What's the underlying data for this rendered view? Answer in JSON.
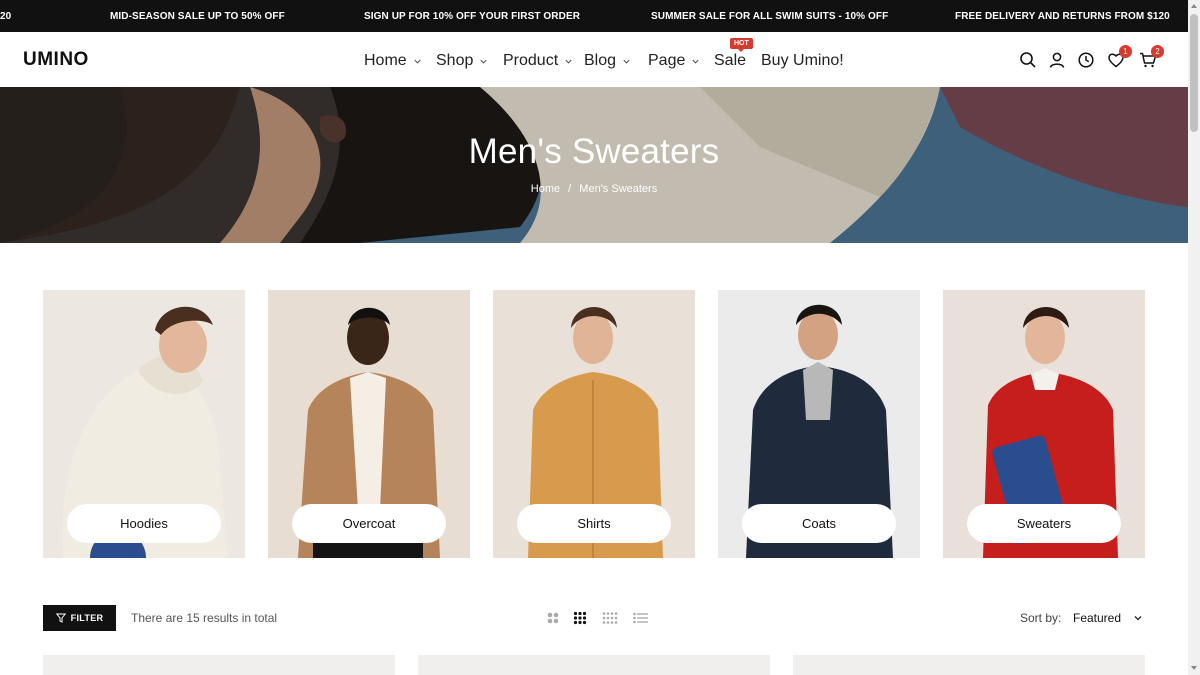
{
  "announcements": [
    "20",
    "MID-SEASON SALE UP TO 50% OFF",
    "SIGN UP FOR 10% OFF YOUR FIRST ORDER",
    "SUMMER SALE FOR ALL SWIM SUITS - 10% OFF",
    "FREE DELIVERY AND RETURNS FROM $120"
  ],
  "header": {
    "logo": "UMINO",
    "nav": [
      {
        "label": "Home",
        "has_dropdown": true
      },
      {
        "label": "Shop",
        "has_dropdown": true
      },
      {
        "label": "Product",
        "has_dropdown": true
      },
      {
        "label": "Blog",
        "has_dropdown": true
      },
      {
        "label": "Page",
        "has_dropdown": true
      },
      {
        "label": "Sale",
        "has_dropdown": false
      },
      {
        "label": "Buy Umino!",
        "has_dropdown": false
      }
    ],
    "hot_badge": "HOT",
    "icons": [
      "search-icon",
      "account-icon",
      "recently-viewed-icon",
      "wishlist-icon",
      "cart-icon"
    ],
    "wishlist_count": "1",
    "cart_count": "2"
  },
  "hero": {
    "title": "Men's Sweaters",
    "breadcrumb": [
      "Home",
      "Men's Sweaters"
    ],
    "breadcrumb_separator": "/"
  },
  "categories": [
    {
      "label": "Hoodies",
      "bg": "#ece7e1",
      "garment": "#f1ece2"
    },
    {
      "label": "Overcoat",
      "bg": "#e8ddd2",
      "garment": "#b5845a"
    },
    {
      "label": "Shirts",
      "bg": "#e9e0d8",
      "garment": "#d89b4e"
    },
    {
      "label": "Coats",
      "bg": "#ebebec",
      "garment": "#1f2b3d"
    },
    {
      "label": "Sweaters",
      "bg": "#e8e0d9",
      "garment": "#c61d1d"
    }
  ],
  "toolbar": {
    "filter_label": "FILTER",
    "results_text": "There are 15 results in total",
    "view_modes": [
      "grid-2-icon",
      "grid-3-icon",
      "grid-4-icon",
      "list-icon"
    ],
    "active_view": "grid-3-icon",
    "sort_label": "Sort by:",
    "sort_value": "Featured"
  },
  "colors": {
    "accent": "#d63b2f",
    "dark": "#111111",
    "hero_bg": "#4e7696"
  }
}
